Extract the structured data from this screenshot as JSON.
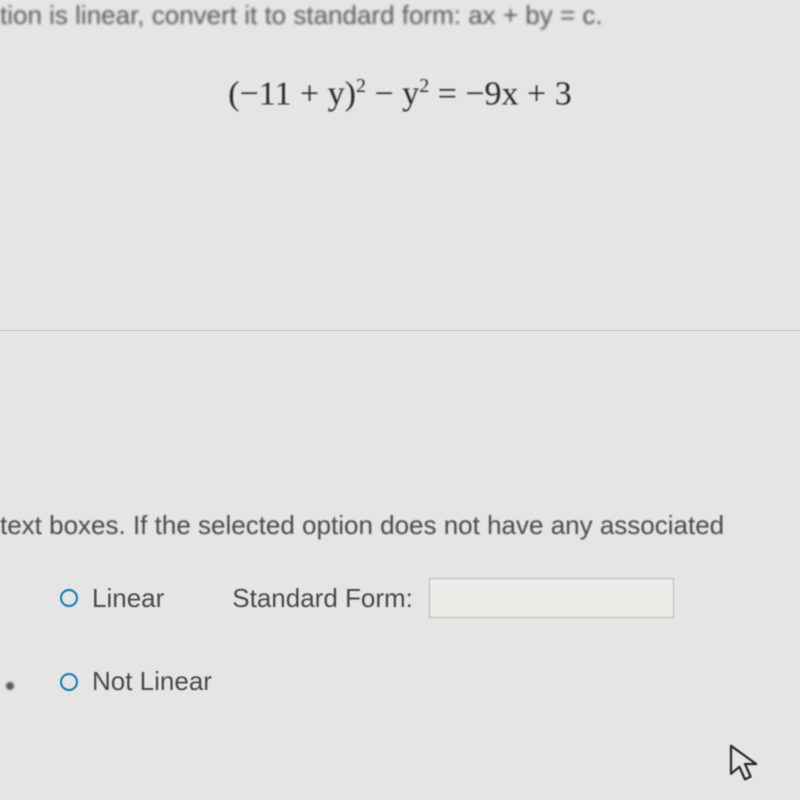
{
  "header": {
    "partial_instruction": "tion is linear, convert it to standard form: ax + by = c."
  },
  "equation": {
    "lhs_part1": "(−11 + y)",
    "lhs_exp1": "2",
    "lhs_middle": " − y",
    "lhs_exp2": "2",
    "rhs": " = −9x + 3"
  },
  "instruction": {
    "partial_text": " text boxes. If the selected option does not have any associated"
  },
  "options": {
    "linear": {
      "label": "Linear",
      "field_label": "Standard Form:",
      "value": ""
    },
    "not_linear": {
      "label": "Not Linear"
    }
  }
}
